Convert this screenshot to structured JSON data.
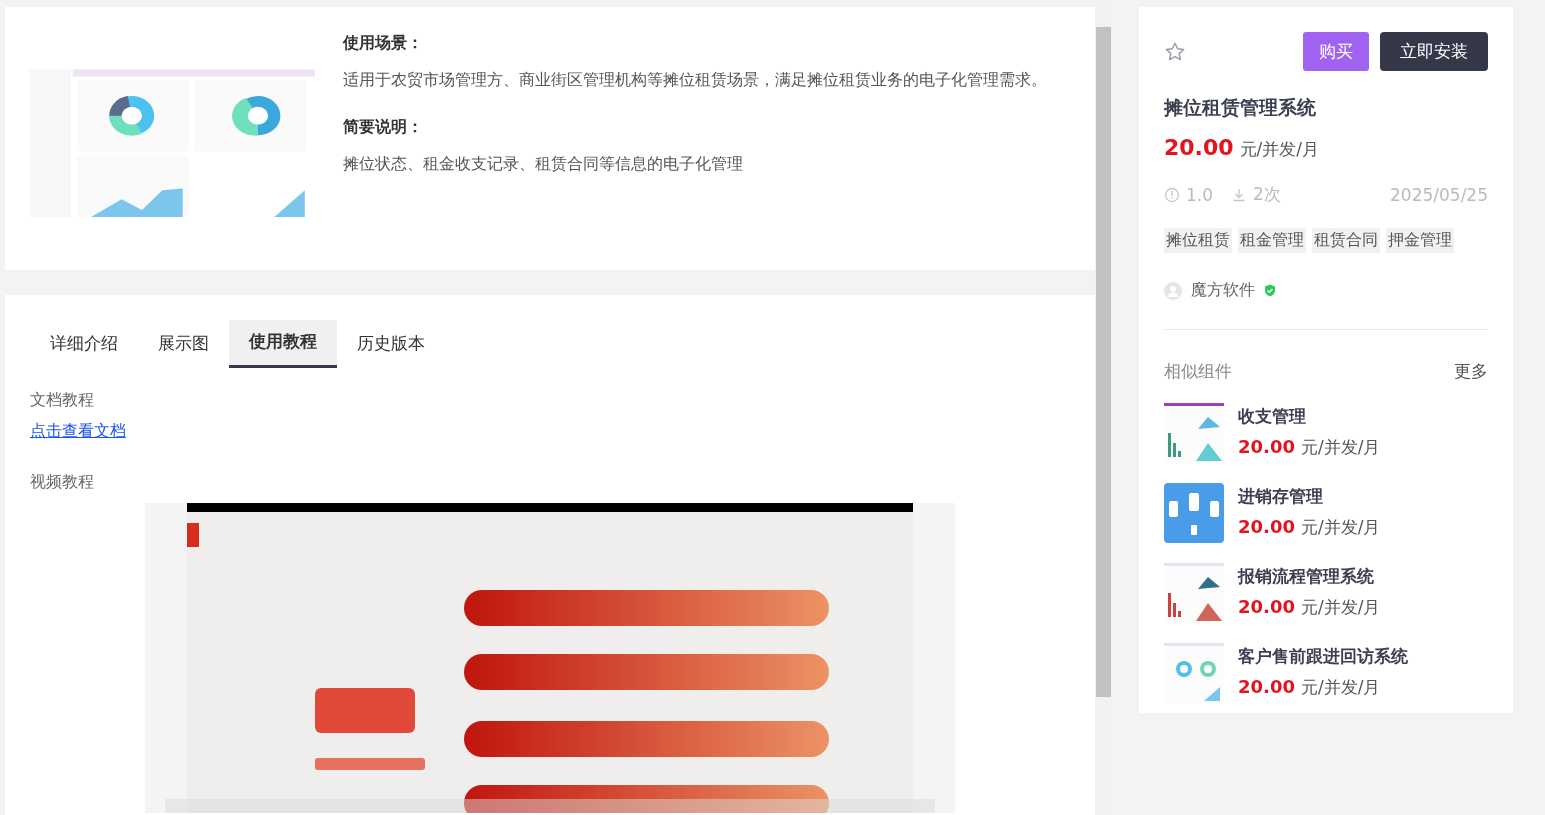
{
  "overview": {
    "sections": [
      {
        "heading": "使用场景：",
        "text": "适用于农贸市场管理方、商业街区管理机构等摊位租赁场景，满足摊位租赁业务的电子化管理需求。"
      },
      {
        "heading": "简要说明：",
        "text": "摊位状态、租金收支记录、租赁合同等信息的电子化管理"
      }
    ]
  },
  "tabs": [
    {
      "label": "详细介绍",
      "selected": false
    },
    {
      "label": "展示图",
      "selected": false
    },
    {
      "label": "使用教程",
      "selected": true
    },
    {
      "label": "历史版本",
      "selected": false
    }
  ],
  "tutorial": {
    "doc_heading": "文档教程",
    "doc_link": "点击查看文档",
    "video_heading": "视频教程"
  },
  "product": {
    "favorite": false,
    "buy_button": "购买",
    "install_button": "立即安装",
    "name": "摊位租赁管理系统",
    "price": "20.00",
    "price_unit": "元/并发/月",
    "version": "1.0",
    "downloads": "2次",
    "date": "2025/05/25",
    "tags": [
      "摊位租赁",
      "租金管理",
      "租赁合同",
      "押金管理"
    ],
    "vendor": "魔方软件",
    "verified": true
  },
  "similar": {
    "title": "相似组件",
    "more": "更多",
    "items": [
      {
        "name": "收支管理",
        "price": "20.00",
        "price_unit": "元/并发/月"
      },
      {
        "name": "进销存管理",
        "price": "20.00",
        "price_unit": "元/并发/月"
      },
      {
        "name": "报销流程管理系统",
        "price": "20.00",
        "price_unit": "元/并发/月"
      },
      {
        "name": "客户售前跟进回访系统",
        "price": "20.00",
        "price_unit": "元/并发/月"
      }
    ]
  }
}
